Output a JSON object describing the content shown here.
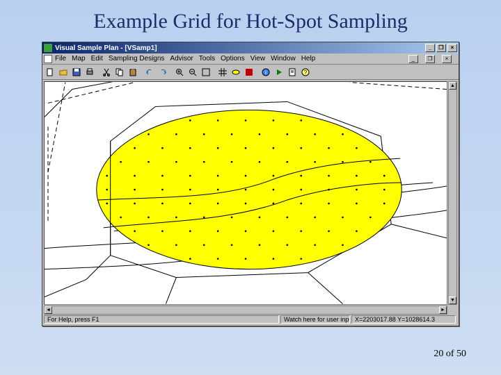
{
  "slide": {
    "title": "Example Grid for Hot-Spot Sampling",
    "page_current": "20",
    "page_sep": " of ",
    "page_total": "50"
  },
  "window": {
    "title": "Visual Sample Plan - [VSamp1]",
    "control_minimize": "_",
    "control_maximize": "❐",
    "control_close": "×"
  },
  "menu": {
    "file": "File",
    "map": "Map",
    "edit": "Edit",
    "sampling": "Sampling Designs",
    "advisor": "Advisor",
    "tools": "Tools",
    "options": "Options",
    "view": "View",
    "window": "Window",
    "help": "Help",
    "doc_min": "_",
    "doc_max": "❐",
    "doc_close": "×"
  },
  "toolbar": {
    "icons": [
      "new-icon",
      "open-icon",
      "save-icon",
      "print-icon",
      "cut-icon",
      "copy-icon",
      "paste-icon",
      "undo-icon",
      "redo-icon",
      "zoom-in-icon",
      "zoom-out-icon",
      "zoom-fit-icon",
      "grid-icon",
      "shape-icon",
      "color-icon",
      "info-icon",
      "run-icon",
      "report-icon",
      "help-icon"
    ]
  },
  "status": {
    "help": "For Help, press F1",
    "watch": "Watch here for user input",
    "coords": "X=2203017.88 Y=1028614.3"
  },
  "colors": {
    "hotspot_fill": "#ffff00",
    "hotspot_stroke": "#000000",
    "grid_dot": "#000000",
    "contour": "#000000"
  }
}
